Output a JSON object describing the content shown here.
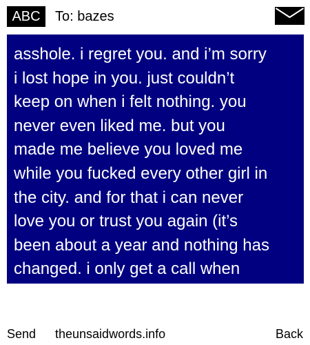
{
  "header": {
    "mode": "ABC",
    "recipient": "To: bazes",
    "envelope_icon": "envelope-icon"
  },
  "message": {
    "text": "asshole. i regret you. and i’m sorry\ni lost hope in you. just couldn’t\nkeep on when i felt nothing. you\nnever even liked me. but you\nmade me believe you loved me\nwhile you fucked every other girl in\nthe city. and for that i can never\nlove you or trust you again (it’s\nbeen about a year and nothing has\nchanged. i only get a call when",
    "background_color": "#000080",
    "text_color": "#ffffff"
  },
  "footer": {
    "send_label": "Send",
    "site_label": "theunsaidwords.info",
    "back_label": "Back"
  }
}
